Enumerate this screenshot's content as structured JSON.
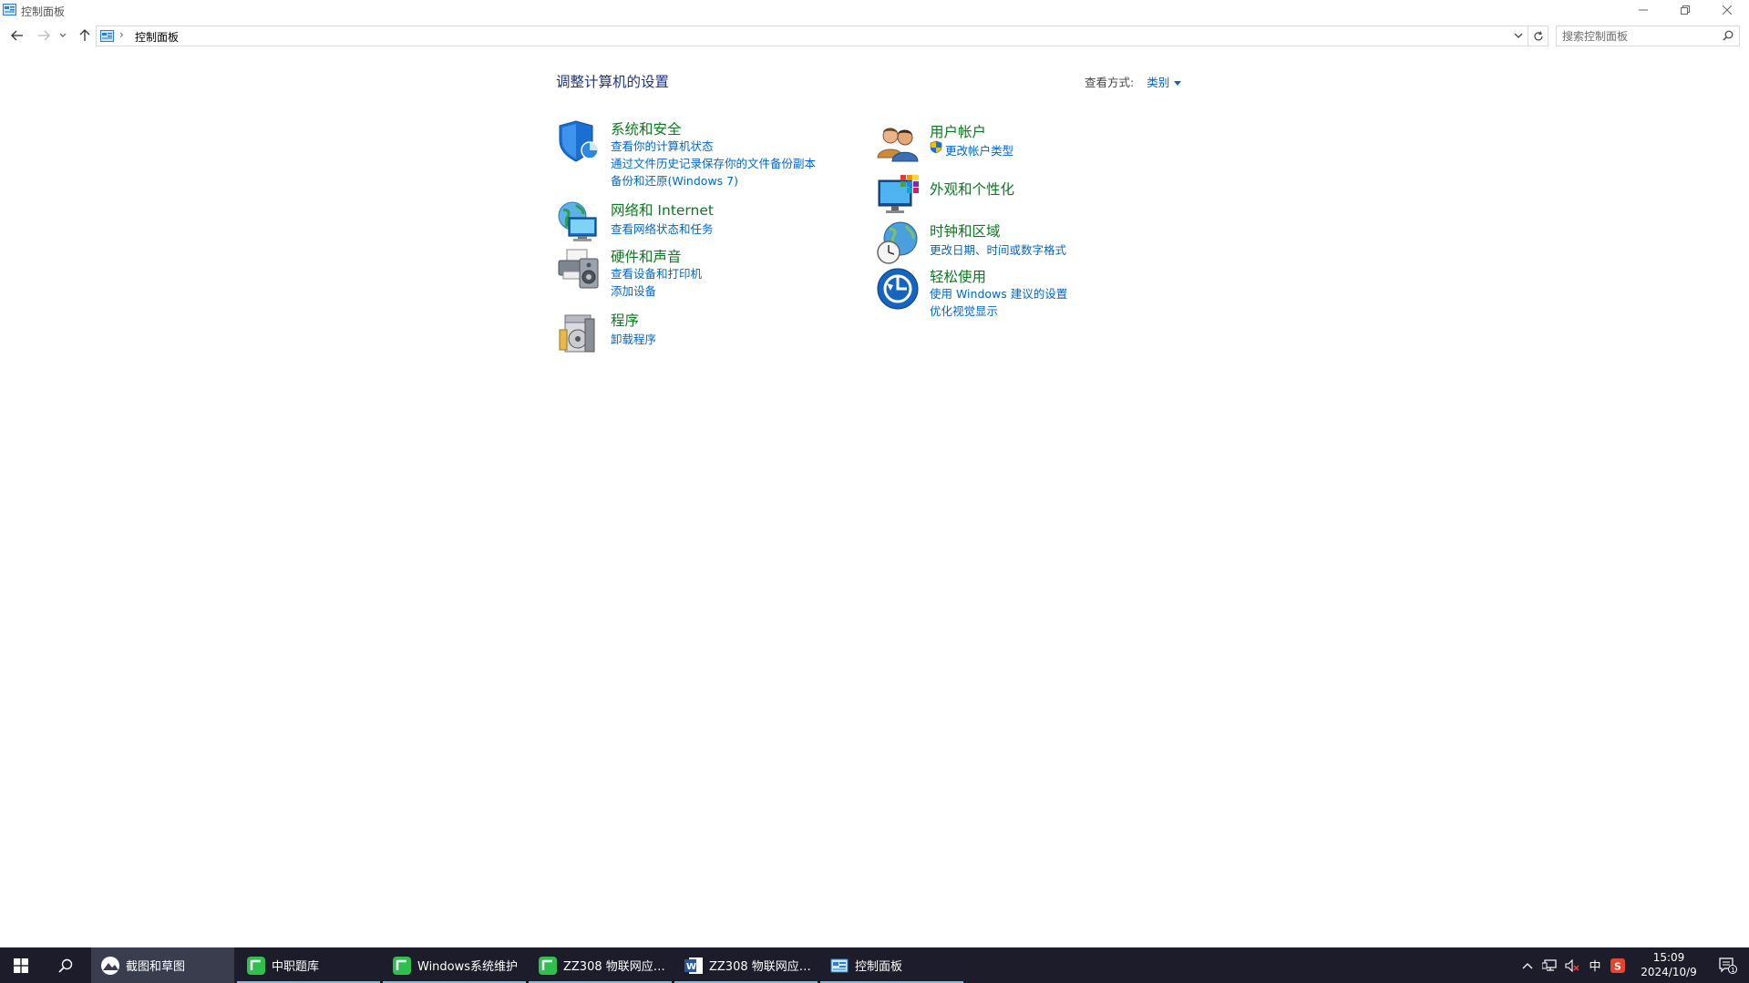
{
  "window": {
    "title": "控制面板",
    "buttons": {
      "minimize": "minimize-icon",
      "maximize": "restore-icon",
      "close": "close-icon"
    }
  },
  "address_bar": {
    "path": "控制面板",
    "separator": "›",
    "search_placeholder": "搜索控制面板"
  },
  "content": {
    "page_title": "调整计算机的设置",
    "view_by_label": "查看方式:",
    "view_by_value": "类别",
    "left_column": [
      {
        "title": "系统和安全",
        "icon": "shield-icon",
        "links": [
          "查看你的计算机状态",
          "通过文件历史记录保存你的文件备份副本",
          "备份和还原(Windows 7)"
        ]
      },
      {
        "title": "网络和 Internet",
        "icon": "network-globe-icon",
        "links": [
          "查看网络状态和任务"
        ]
      },
      {
        "title": "硬件和声音",
        "icon": "printer-speaker-icon",
        "links": [
          "查看设备和打印机",
          "添加设备"
        ]
      },
      {
        "title": "程序",
        "icon": "programs-disc-icon",
        "links": [
          "卸载程序"
        ]
      }
    ],
    "right_column": [
      {
        "title": "用户帐户",
        "icon": "users-icon",
        "links": [
          "更改帐户类型"
        ]
      },
      {
        "title": "外观和个性化",
        "icon": "monitor-palette-icon",
        "links": []
      },
      {
        "title": "时钟和区域",
        "icon": "clock-globe-icon",
        "links": [
          "更改日期、时间或数字格式"
        ]
      },
      {
        "title": "轻松使用",
        "icon": "ease-of-access-icon",
        "links": [
          "使用 Windows 建议的设置",
          "优化视觉显示"
        ]
      }
    ]
  },
  "taskbar": {
    "apps": [
      {
        "label": "截图和草图",
        "active": true
      },
      {
        "label": "中职题库",
        "active": false
      },
      {
        "label": "Windows系统维护",
        "active": false
      },
      {
        "label": "ZZ308 物联网应用...",
        "active": false
      },
      {
        "label": "ZZ308 物联网应用...",
        "active": false
      },
      {
        "label": "控制面板",
        "active": false
      }
    ],
    "ime": "中",
    "time": "15:09",
    "date": "2024/10/9",
    "notification_count": "1"
  },
  "colors": {
    "title_blue": "#1e3287",
    "category_green": "#0a7a1e",
    "link_blue": "#0066cc",
    "taskbar_bg": "#1c1c2b"
  }
}
